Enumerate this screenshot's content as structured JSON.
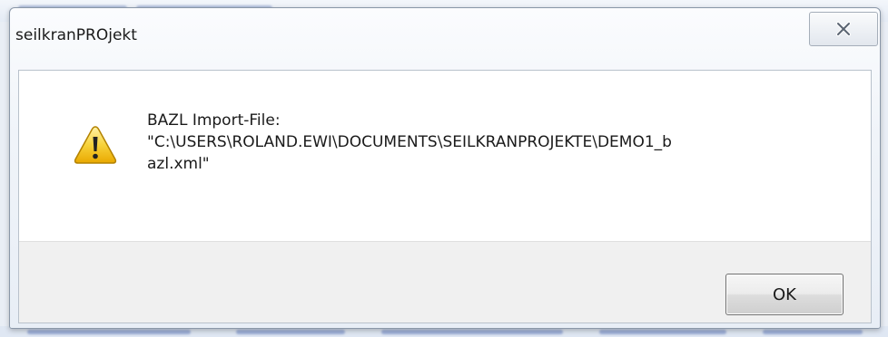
{
  "dialog": {
    "title": "seilkranPROjekt",
    "close_icon": "close-icon",
    "icon": "warning-icon",
    "message_lines": [
      "BAZL Import-File:",
      "\"C:\\USERS\\ROLAND.EWI\\DOCUMENTS\\SEILKRANPROJEKTE\\DEMO1_b",
      "azl.xml\""
    ],
    "ok_label": "OK"
  },
  "colors": {
    "warning_fill": "#f5c518",
    "warning_border": "#b38200",
    "dialog_border": "#8a97a8",
    "button_area": "#f0f0f0"
  }
}
